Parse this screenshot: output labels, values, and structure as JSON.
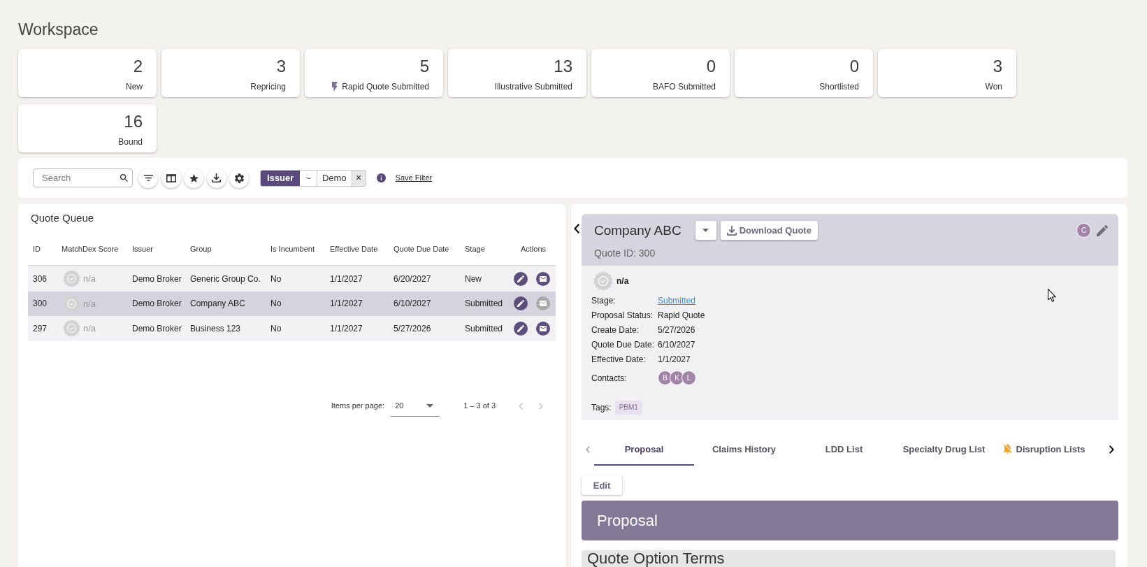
{
  "page": {
    "title": "Workspace"
  },
  "stat_cards": [
    {
      "count": "2",
      "label": "New",
      "kind": "plain"
    },
    {
      "count": "3",
      "label": "Repricing",
      "kind": "plain"
    },
    {
      "count": "5",
      "label": "Rapid Quote Submitted",
      "kind": "flagged"
    },
    {
      "count": "13",
      "label": "Illustrative Submitted",
      "kind": "plain"
    },
    {
      "count": "0",
      "label": "BAFO Submitted",
      "kind": "plain"
    },
    {
      "count": "0",
      "label": "Shortlisted",
      "kind": "plain"
    },
    {
      "count": "3",
      "label": "Won",
      "kind": "plain"
    },
    {
      "count": "16",
      "label": "Bound",
      "kind": "plain"
    }
  ],
  "toolbar": {
    "search": {
      "placeholder": "Search"
    },
    "filter_chip": {
      "field": "Issuer",
      "operator": "~",
      "value": "Demo",
      "remove": "×"
    },
    "save_filter": "Save Filter"
  },
  "quote_queue": {
    "title": "Quote Queue",
    "columns": [
      "ID",
      "MatchDex Score",
      "Issuer",
      "Group",
      "Is Incumbent",
      "Effective Date",
      "Quote Due Date",
      "Stage",
      "Actions"
    ],
    "rows": [
      {
        "id": "306",
        "score": "n/a",
        "issuer": "Demo Broker",
        "group": "Generic Group Co.",
        "is_incumbent": "No",
        "effective_date": "1/1/2027",
        "quote_due_date": "6/20/2027",
        "stage": "New",
        "selected": false,
        "email_enabled": true
      },
      {
        "id": "300",
        "score": "n/a",
        "issuer": "Demo Broker",
        "group": "Company ABC",
        "is_incumbent": "No",
        "effective_date": "1/1/2027",
        "quote_due_date": "6/10/2027",
        "stage": "Submitted",
        "selected": true,
        "email_enabled": false
      },
      {
        "id": "297",
        "score": "n/a",
        "issuer": "Demo Broker",
        "group": "Business 123",
        "is_incumbent": "No",
        "effective_date": "1/1/2027",
        "quote_due_date": "5/27/2026",
        "stage": "Submitted",
        "selected": false,
        "email_enabled": true
      }
    ],
    "pagination": {
      "label": "Items per page:",
      "page_size": "20",
      "range": "1 – 3 of 3",
      "previous_enabled": false,
      "next_enabled": false
    }
  },
  "quote_detail": {
    "company": "Company ABC",
    "download_button": "Download Quote",
    "owner_initial": "C",
    "quote_id": "Quote ID: 300",
    "score": "n/a",
    "fields": [
      {
        "label": "Stage:",
        "value": "Submitted",
        "kind": "link"
      },
      {
        "label": "Proposal Status:",
        "value": "Rapid Quote",
        "kind": "text"
      },
      {
        "label": "Create Date:",
        "value": "5/27/2026",
        "kind": "text"
      },
      {
        "label": "Quote Due Date:",
        "value": "6/10/2027",
        "kind": "text"
      },
      {
        "label": "Effective Date:",
        "value": "1/1/2027",
        "kind": "text"
      }
    ],
    "contacts_label": "Contacts:",
    "contacts": [
      "B",
      "K",
      "L"
    ],
    "tags_label": "Tags:",
    "tags": [
      "PBM1"
    ]
  },
  "tabs": [
    {
      "label": "Proposal",
      "selected": true,
      "kind": "plain"
    },
    {
      "label": "Claims History",
      "selected": false,
      "kind": "plain"
    },
    {
      "label": "LDD List",
      "selected": false,
      "kind": "plain"
    },
    {
      "label": "Specialty Drug List",
      "selected": false,
      "kind": "plain"
    },
    {
      "label": "Disruption Lists",
      "selected": false,
      "kind": "muted"
    }
  ],
  "edit_button": "Edit",
  "section": {
    "title": "Proposal"
  },
  "subsection": {
    "title": "Quote Option Terms"
  }
}
